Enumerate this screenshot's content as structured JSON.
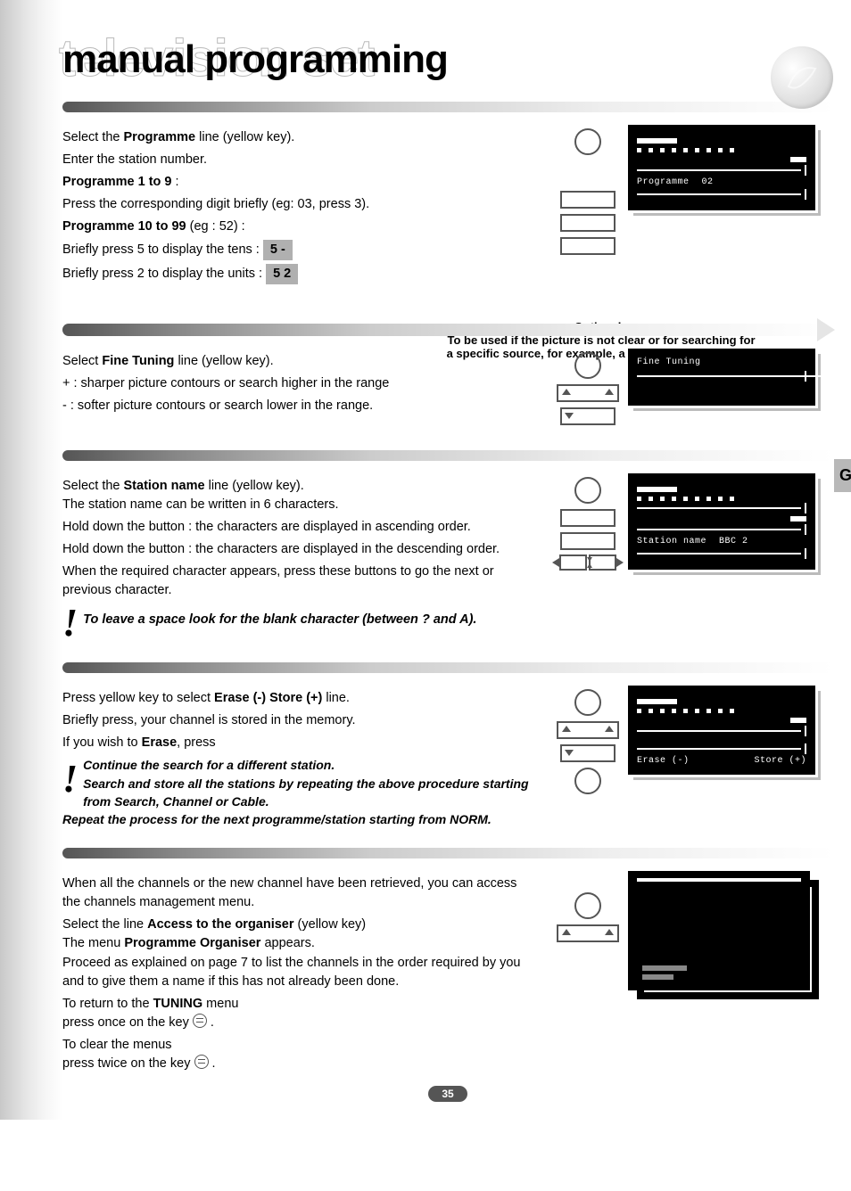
{
  "header": {
    "ghost_title": "television set",
    "main_title": "manual programming"
  },
  "side_tab": "GB",
  "page_number": "35",
  "section1": {
    "p1_pre": "Select the ",
    "p1_bold": "Programme",
    "p1_post": " line (yellow key).",
    "p2": "Enter the station number.",
    "p3_bold": "Programme 1 to 9",
    "p3_post": " :",
    "p4": "Press the corresponding digit briefly (eg: 03, press 3).",
    "p5_bold": "Programme 10 to 99",
    "p5_post": " (eg : 52) :",
    "p6": "Briefly press 5 to display the tens :",
    "badge1": "5 -",
    "p7": "Briefly press 2  to display the units :",
    "badge2": "5 2",
    "screen": {
      "label": "Programme",
      "value": "02"
    }
  },
  "optional": {
    "title": "Optional :",
    "line1": "To be used if the picture is not clear or for searching for",
    "line2": "a specific source, for example, a video recorder channel"
  },
  "section2": {
    "p1_pre": "Select ",
    "p1_bold": "Fine Tuning",
    "p1_post": " line (yellow key).",
    "p2": "+ : sharper picture contours or search higher in the range",
    "p3": "- : softer picture contours or search lower in the range.",
    "screen": {
      "label": "Fine Tuning"
    }
  },
  "section3": {
    "p1_pre": "Select the ",
    "p1_bold": "Station name",
    "p1_post": " line (yellow key).",
    "p2": "The station name can be written in 6 characters.",
    "p3": "Hold down the button : the characters are displayed in ascending order.",
    "p4": "Hold down the button : the characters are displayed in the descending order.",
    "p5": "When the required character appears, press these buttons to go the next or previous character.",
    "p6": "To leave a space look for the blank character (between ? and A).",
    "screen": {
      "label": "Station name",
      "value": "BBC 2"
    }
  },
  "section4": {
    "p1_pre": "Press yellow key to select ",
    "p1_bold": "Erase (-)  Store (+)",
    "p1_post": " line.",
    "p2": "Briefly press, your channel is stored in the memory.",
    "p3_pre": "If you wish to ",
    "p3_bold": "Erase",
    "p3_post": ", press",
    "n1": "Continue the search for a different station.",
    "n2": "Search and store all the stations by repeating the above procedure starting from Search, Channel or Cable.",
    "n3": "Repeat the process for the next programme/station starting from NORM.",
    "screen": {
      "left": "Erase (-)",
      "right": "Store (+)"
    }
  },
  "section5": {
    "p1": "When all the channels or the new channel have been retrieved, you can access the channels management menu.",
    "p2_pre": "Select the line ",
    "p2_bold": "Access to the organiser",
    "p2_post": " (yellow key)",
    "p3_pre": "The menu ",
    "p3_bold": "Programme Organiser",
    "p3_post": " appears.",
    "p4": "Proceed as explained on page 7 to list the channels in the order required by you and to give them a name if this has not already been done.",
    "p5_pre": "To return to the ",
    "p5_bold": "TUNING",
    "p5_post": " menu",
    "p6": "press once on the key ",
    "p7": "To clear the menus",
    "p8": "press twice on the key ",
    "dot": " ."
  }
}
